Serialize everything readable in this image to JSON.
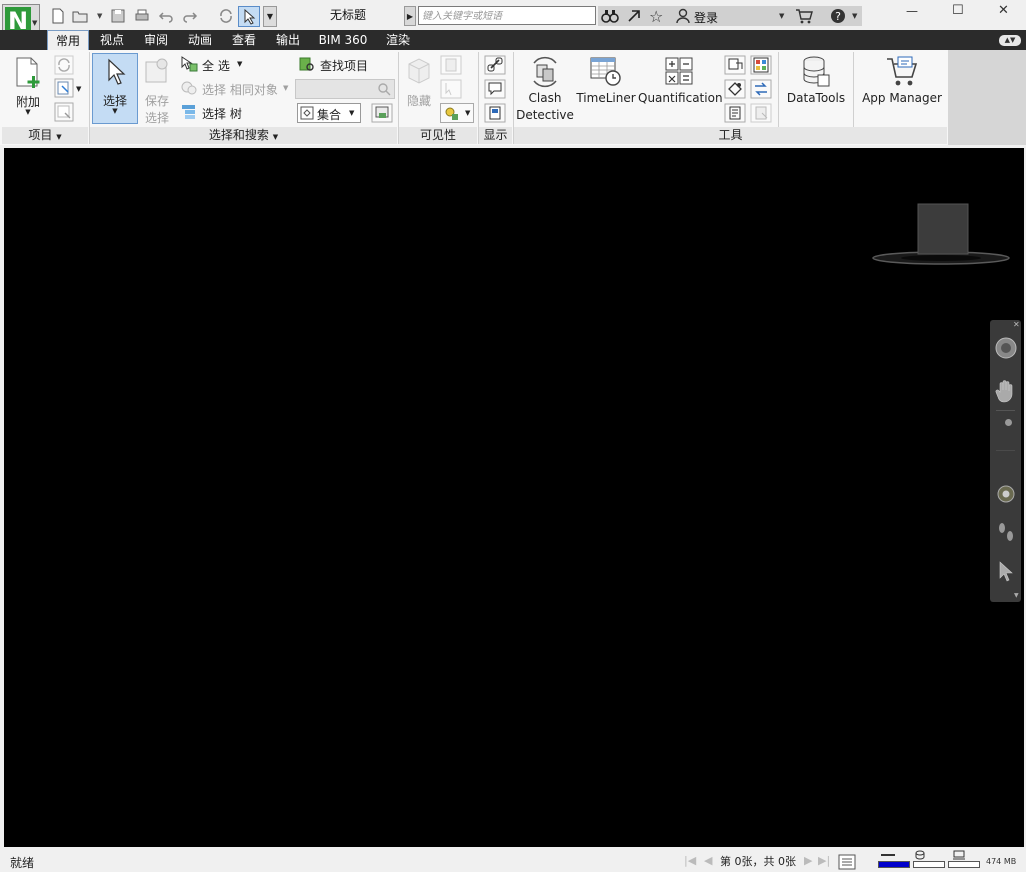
{
  "window": {
    "title": "无标题",
    "controls": {
      "minimize": "—",
      "maximize": "☐",
      "close": "✕"
    }
  },
  "app": {
    "logo": "N"
  },
  "search": {
    "placeholder": "键入关键字或短语"
  },
  "account": {
    "login_label": "登录"
  },
  "tabs": [
    {
      "label": "常用",
      "active": true
    },
    {
      "label": "视点"
    },
    {
      "label": "审阅"
    },
    {
      "label": "动画"
    },
    {
      "label": "查看"
    },
    {
      "label": "输出"
    },
    {
      "label": "BIM 360"
    },
    {
      "label": "渲染"
    }
  ],
  "ribbon": {
    "project": {
      "append_label": "附加",
      "panel_label": "项目"
    },
    "select": {
      "select_label": "选择",
      "save_label_1": "保存",
      "save_label_2": "选择",
      "select_all_label": "全 选",
      "select_same_label": "选择 相同对象",
      "select_tree_label": "选择 树",
      "find_items_label": "查找项目",
      "sets_label": "集合",
      "panel_label": "选择和搜索"
    },
    "visibility": {
      "hide_label": "隐藏",
      "panel_label": "可见性"
    },
    "display": {
      "panel_label": "显示"
    },
    "tools": {
      "clash_label_1": "Clash",
      "clash_label_2": "Detective",
      "timeliner_label": "TimeLiner",
      "quantification_label": "Quantification",
      "datatools_label": "DataTools",
      "appmanager_label": "App Manager",
      "panel_label": "工具"
    }
  },
  "status": {
    "ready": "就绪",
    "sheet_info": "第 0张，共 0张",
    "memory": "474 MB"
  },
  "colors": {
    "logo_green": "#2e9a3a",
    "tab_bar": "#2b2b2b",
    "viewport": "#000000",
    "select_active": "#c4dcf4",
    "progress_blue": "#0000cc"
  }
}
